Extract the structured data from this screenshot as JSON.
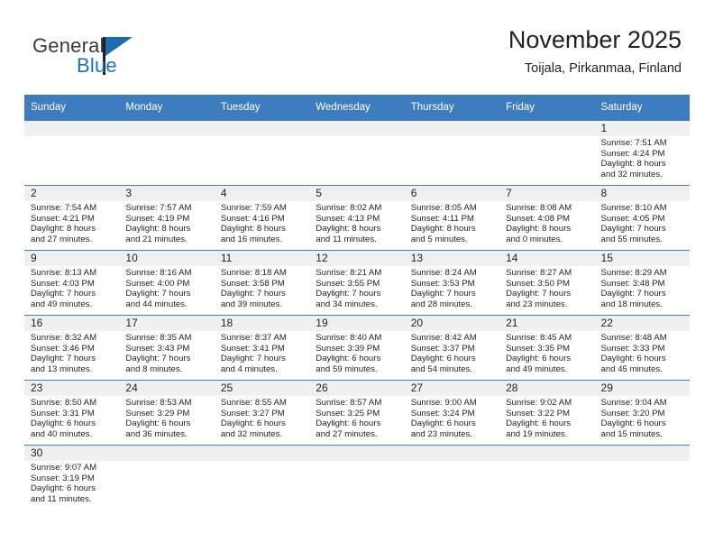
{
  "brand": {
    "name_part1": "General",
    "name_part2": "Blue",
    "flag_icon": "flag-icon",
    "accent_color": "#1b6cb0"
  },
  "header": {
    "title": "November 2025",
    "subtitle": "Toijala, Pirkanmaa, Finland"
  },
  "calendar": {
    "header_bg": "#3d7cbf",
    "daynum_bg": "#f0f0f0",
    "weekdays": [
      "Sunday",
      "Monday",
      "Tuesday",
      "Wednesday",
      "Thursday",
      "Friday",
      "Saturday"
    ],
    "weeks": [
      [
        {
          "day": "",
          "empty": true
        },
        {
          "day": "",
          "empty": true
        },
        {
          "day": "",
          "empty": true
        },
        {
          "day": "",
          "empty": true
        },
        {
          "day": "",
          "empty": true
        },
        {
          "day": "",
          "empty": true
        },
        {
          "day": "1",
          "sunrise": "Sunrise: 7:51 AM",
          "sunset": "Sunset: 4:24 PM",
          "daylight1": "Daylight: 8 hours",
          "daylight2": "and 32 minutes."
        }
      ],
      [
        {
          "day": "2",
          "sunrise": "Sunrise: 7:54 AM",
          "sunset": "Sunset: 4:21 PM",
          "daylight1": "Daylight: 8 hours",
          "daylight2": "and 27 minutes."
        },
        {
          "day": "3",
          "sunrise": "Sunrise: 7:57 AM",
          "sunset": "Sunset: 4:19 PM",
          "daylight1": "Daylight: 8 hours",
          "daylight2": "and 21 minutes."
        },
        {
          "day": "4",
          "sunrise": "Sunrise: 7:59 AM",
          "sunset": "Sunset: 4:16 PM",
          "daylight1": "Daylight: 8 hours",
          "daylight2": "and 16 minutes."
        },
        {
          "day": "5",
          "sunrise": "Sunrise: 8:02 AM",
          "sunset": "Sunset: 4:13 PM",
          "daylight1": "Daylight: 8 hours",
          "daylight2": "and 11 minutes."
        },
        {
          "day": "6",
          "sunrise": "Sunrise: 8:05 AM",
          "sunset": "Sunset: 4:11 PM",
          "daylight1": "Daylight: 8 hours",
          "daylight2": "and 5 minutes."
        },
        {
          "day": "7",
          "sunrise": "Sunrise: 8:08 AM",
          "sunset": "Sunset: 4:08 PM",
          "daylight1": "Daylight: 8 hours",
          "daylight2": "and 0 minutes."
        },
        {
          "day": "8",
          "sunrise": "Sunrise: 8:10 AM",
          "sunset": "Sunset: 4:05 PM",
          "daylight1": "Daylight: 7 hours",
          "daylight2": "and 55 minutes."
        }
      ],
      [
        {
          "day": "9",
          "sunrise": "Sunrise: 8:13 AM",
          "sunset": "Sunset: 4:03 PM",
          "daylight1": "Daylight: 7 hours",
          "daylight2": "and 49 minutes."
        },
        {
          "day": "10",
          "sunrise": "Sunrise: 8:16 AM",
          "sunset": "Sunset: 4:00 PM",
          "daylight1": "Daylight: 7 hours",
          "daylight2": "and 44 minutes."
        },
        {
          "day": "11",
          "sunrise": "Sunrise: 8:18 AM",
          "sunset": "Sunset: 3:58 PM",
          "daylight1": "Daylight: 7 hours",
          "daylight2": "and 39 minutes."
        },
        {
          "day": "12",
          "sunrise": "Sunrise: 8:21 AM",
          "sunset": "Sunset: 3:55 PM",
          "daylight1": "Daylight: 7 hours",
          "daylight2": "and 34 minutes."
        },
        {
          "day": "13",
          "sunrise": "Sunrise: 8:24 AM",
          "sunset": "Sunset: 3:53 PM",
          "daylight1": "Daylight: 7 hours",
          "daylight2": "and 28 minutes."
        },
        {
          "day": "14",
          "sunrise": "Sunrise: 8:27 AM",
          "sunset": "Sunset: 3:50 PM",
          "daylight1": "Daylight: 7 hours",
          "daylight2": "and 23 minutes."
        },
        {
          "day": "15",
          "sunrise": "Sunrise: 8:29 AM",
          "sunset": "Sunset: 3:48 PM",
          "daylight1": "Daylight: 7 hours",
          "daylight2": "and 18 minutes."
        }
      ],
      [
        {
          "day": "16",
          "sunrise": "Sunrise: 8:32 AM",
          "sunset": "Sunset: 3:46 PM",
          "daylight1": "Daylight: 7 hours",
          "daylight2": "and 13 minutes."
        },
        {
          "day": "17",
          "sunrise": "Sunrise: 8:35 AM",
          "sunset": "Sunset: 3:43 PM",
          "daylight1": "Daylight: 7 hours",
          "daylight2": "and 8 minutes."
        },
        {
          "day": "18",
          "sunrise": "Sunrise: 8:37 AM",
          "sunset": "Sunset: 3:41 PM",
          "daylight1": "Daylight: 7 hours",
          "daylight2": "and 4 minutes."
        },
        {
          "day": "19",
          "sunrise": "Sunrise: 8:40 AM",
          "sunset": "Sunset: 3:39 PM",
          "daylight1": "Daylight: 6 hours",
          "daylight2": "and 59 minutes."
        },
        {
          "day": "20",
          "sunrise": "Sunrise: 8:42 AM",
          "sunset": "Sunset: 3:37 PM",
          "daylight1": "Daylight: 6 hours",
          "daylight2": "and 54 minutes."
        },
        {
          "day": "21",
          "sunrise": "Sunrise: 8:45 AM",
          "sunset": "Sunset: 3:35 PM",
          "daylight1": "Daylight: 6 hours",
          "daylight2": "and 49 minutes."
        },
        {
          "day": "22",
          "sunrise": "Sunrise: 8:48 AM",
          "sunset": "Sunset: 3:33 PM",
          "daylight1": "Daylight: 6 hours",
          "daylight2": "and 45 minutes."
        }
      ],
      [
        {
          "day": "23",
          "sunrise": "Sunrise: 8:50 AM",
          "sunset": "Sunset: 3:31 PM",
          "daylight1": "Daylight: 6 hours",
          "daylight2": "and 40 minutes."
        },
        {
          "day": "24",
          "sunrise": "Sunrise: 8:53 AM",
          "sunset": "Sunset: 3:29 PM",
          "daylight1": "Daylight: 6 hours",
          "daylight2": "and 36 minutes."
        },
        {
          "day": "25",
          "sunrise": "Sunrise: 8:55 AM",
          "sunset": "Sunset: 3:27 PM",
          "daylight1": "Daylight: 6 hours",
          "daylight2": "and 32 minutes."
        },
        {
          "day": "26",
          "sunrise": "Sunrise: 8:57 AM",
          "sunset": "Sunset: 3:25 PM",
          "daylight1": "Daylight: 6 hours",
          "daylight2": "and 27 minutes."
        },
        {
          "day": "27",
          "sunrise": "Sunrise: 9:00 AM",
          "sunset": "Sunset: 3:24 PM",
          "daylight1": "Daylight: 6 hours",
          "daylight2": "and 23 minutes."
        },
        {
          "day": "28",
          "sunrise": "Sunrise: 9:02 AM",
          "sunset": "Sunset: 3:22 PM",
          "daylight1": "Daylight: 6 hours",
          "daylight2": "and 19 minutes."
        },
        {
          "day": "29",
          "sunrise": "Sunrise: 9:04 AM",
          "sunset": "Sunset: 3:20 PM",
          "daylight1": "Daylight: 6 hours",
          "daylight2": "and 15 minutes."
        }
      ],
      [
        {
          "day": "30",
          "sunrise": "Sunrise: 9:07 AM",
          "sunset": "Sunset: 3:19 PM",
          "daylight1": "Daylight: 6 hours",
          "daylight2": "and 11 minutes."
        },
        {
          "day": "",
          "empty": true
        },
        {
          "day": "",
          "empty": true
        },
        {
          "day": "",
          "empty": true
        },
        {
          "day": "",
          "empty": true
        },
        {
          "day": "",
          "empty": true
        },
        {
          "day": "",
          "empty": true
        }
      ]
    ]
  }
}
